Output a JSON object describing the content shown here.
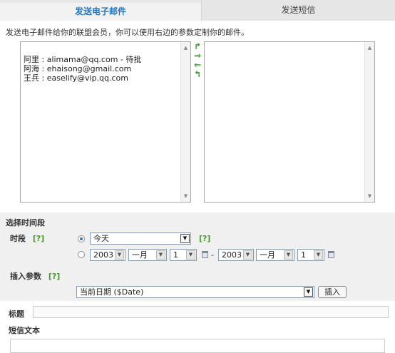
{
  "tabs": [
    {
      "label": "发送电子邮件",
      "active": true
    },
    {
      "label": "发送短信",
      "active": false
    }
  ],
  "intro": "发送电子邮件给你的联盟会员，你可以使用右边的参数定制你的邮件。",
  "recipients": [
    "阿里 : alimama@qq.com - 待批",
    "阿海 : ehaisong@gmail.com",
    "王兵 : easelify@vip.qq.com"
  ],
  "selected_recipients": [],
  "time_section": {
    "title": "选择时间段",
    "period_label": "时段",
    "help": "[?]",
    "preset_select": "今天",
    "preset_help": "[?]",
    "preset_selected": true,
    "range": {
      "from_year": "2003",
      "from_month": "一月",
      "from_day": "1",
      "separator": "-",
      "to_year": "2003",
      "to_month": "一月",
      "to_day": "1"
    }
  },
  "insert_section": {
    "label": "插入参数",
    "help": "[?]",
    "param_select": "当前日期 ($Date)",
    "insert_button": "插入"
  },
  "subject": {
    "label": "标题",
    "value": ""
  },
  "body": {
    "label": "短信文本",
    "value": ""
  },
  "colors": {
    "accent": "#2277bb",
    "help": "#4a9a2a",
    "panel": "#f0f0f0"
  }
}
